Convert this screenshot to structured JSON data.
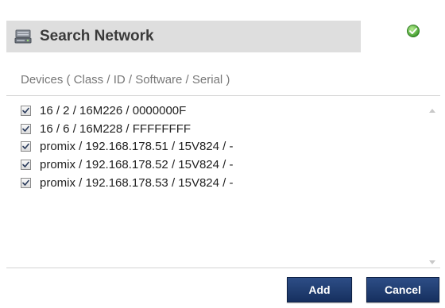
{
  "dialog": {
    "title": "Search Network",
    "title_icon": "network-drive-icon",
    "status_icon": "green-check-icon",
    "list_label": "Devices ( Class / ID / Software / Serial )"
  },
  "devices": [
    {
      "label": "16 / 2 / 16M226 / 0000000F",
      "checked": true
    },
    {
      "label": "16 / 6 / 16M228 / FFFFFFFF",
      "checked": true
    },
    {
      "label": "promix / 192.168.178.51 / 15V824 / -",
      "checked": true
    },
    {
      "label": "promix / 192.168.178.52 / 15V824 / -",
      "checked": true
    },
    {
      "label": "promix / 192.168.178.53 / 15V824 / -",
      "checked": true
    }
  ],
  "buttons": {
    "add_label": "Add",
    "cancel_label": "Cancel"
  },
  "colors": {
    "header_bg": "#dedede",
    "button_bg": "#1f3b6e",
    "status_ok": "#4caf3f"
  }
}
